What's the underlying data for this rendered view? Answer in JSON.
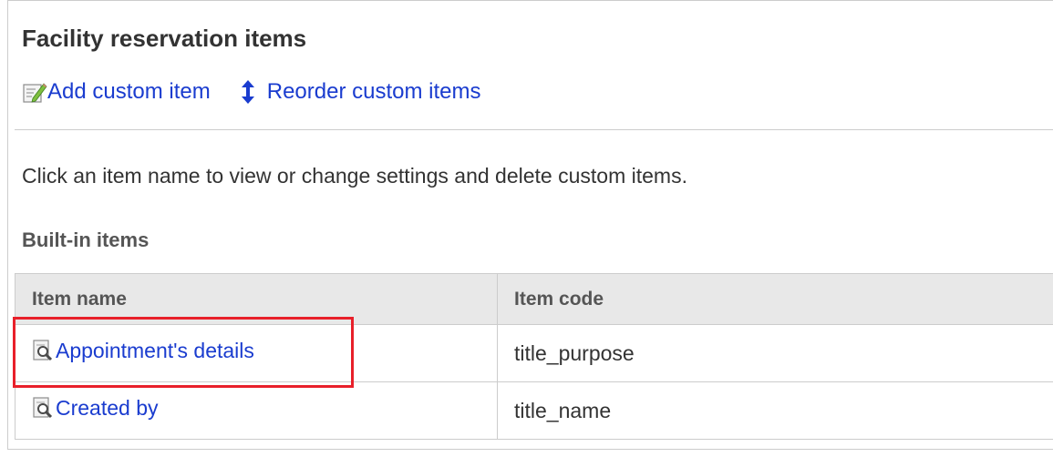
{
  "header": {
    "title": "Facility reservation items"
  },
  "toolbar": {
    "add_label": "Add custom item",
    "add_icon": "edit-pencil-icon",
    "reorder_label": "Reorder custom items",
    "reorder_icon": "up-down-arrow-icon"
  },
  "main": {
    "description": "Click an item name to view or change settings and delete custom items.",
    "section_title": "Built-in items",
    "table": {
      "columns": [
        "Item name",
        "Item code"
      ],
      "rows": [
        {
          "name": "Appointment's details",
          "code": "title_purpose",
          "icon": "item-detail-icon"
        },
        {
          "name": "Created by",
          "code": "title_name",
          "icon": "item-detail-icon"
        }
      ]
    }
  },
  "colors": {
    "link": "#1a3ccf",
    "highlight": "#e8202a",
    "header_bg": "#e8e8e8",
    "border": "#cccccc"
  }
}
